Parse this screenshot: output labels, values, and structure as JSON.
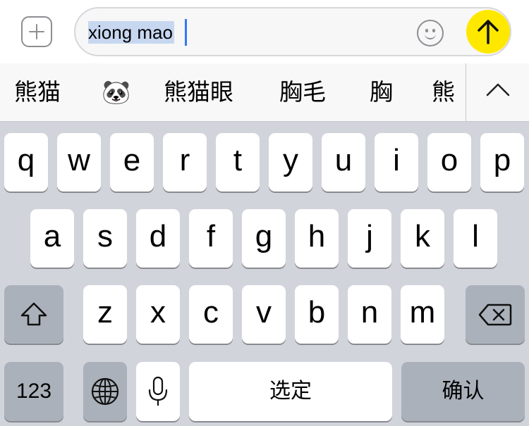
{
  "composer": {
    "typed_text": "xiong mao",
    "send_color": "#ffe800"
  },
  "candidates": {
    "items": [
      "熊猫",
      "🐼",
      "熊猫眼",
      "胸毛",
      "胸",
      "熊"
    ]
  },
  "keyboard": {
    "row1": [
      "q",
      "w",
      "e",
      "r",
      "t",
      "y",
      "u",
      "i",
      "o",
      "p"
    ],
    "row2": [
      "a",
      "s",
      "d",
      "f",
      "g",
      "h",
      "j",
      "k",
      "l"
    ],
    "row3": [
      "z",
      "x",
      "c",
      "v",
      "b",
      "n",
      "m"
    ],
    "numbers_label": "123",
    "space_label": "选定",
    "return_label": "确认"
  }
}
